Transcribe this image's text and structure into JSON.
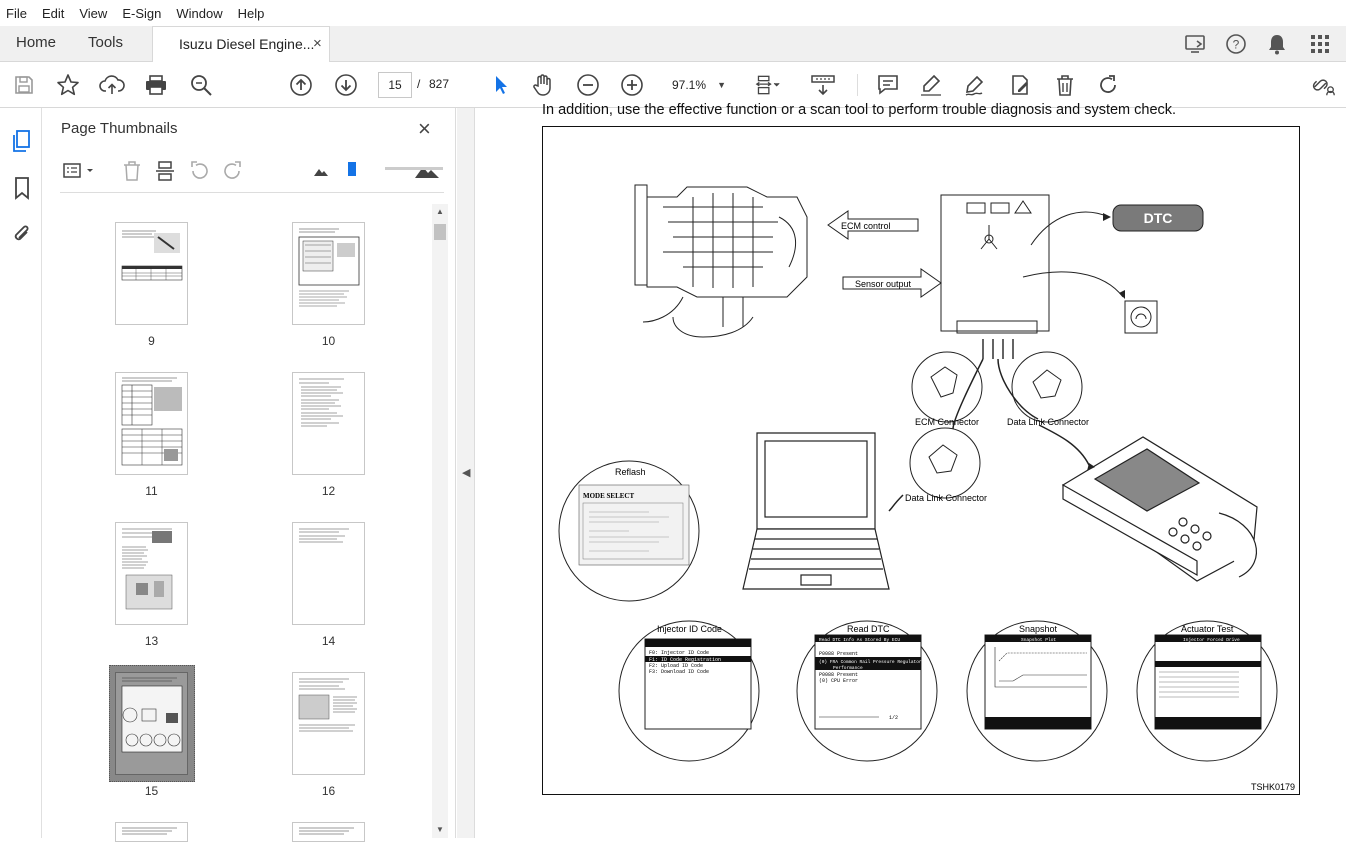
{
  "menu": [
    "File",
    "Edit",
    "View",
    "E-Sign",
    "Window",
    "Help"
  ],
  "tabs": {
    "home": "Home",
    "tools": "Tools",
    "doc_title": "Isuzu Diesel Engine...",
    "close": "×"
  },
  "toolbar": {
    "page_current": "15",
    "page_sep": "/",
    "page_total": "827",
    "zoom": "97.1%"
  },
  "panel": {
    "title": "Page Thumbnails",
    "close": "×"
  },
  "thumbnails": [
    {
      "label": "9"
    },
    {
      "label": "10"
    },
    {
      "label": "11"
    },
    {
      "label": "12"
    },
    {
      "label": "13"
    },
    {
      "label": "14"
    },
    {
      "label": "15"
    },
    {
      "label": "16"
    }
  ],
  "document": {
    "top_text": "In addition, use the effective function or a scan tool to perform trouble diagnosis and system check.",
    "figure": {
      "ecm_control": "ECM control",
      "sensor_output": "Sensor output",
      "dtc": "DTC",
      "ecm_connector": "ECM Connector",
      "data_link_connector_1": "Data Link Connector",
      "data_link_connector_2": "Data Link Connector",
      "reflash": "Reflash",
      "reflash_screen_title": "MODE SELECT",
      "injector_id_code": "Injector ID Code",
      "read_dtc": "Read DTC",
      "snapshot": "Snapshot",
      "actuator_test": "Actuator Test",
      "inj_lines": [
        "F0: Injector ID Code",
        "F1: ID Code Registration",
        "F2: Upload ID Code",
        "F3: Download ID Code"
      ],
      "dtc_lines": [
        "Read DTC Info As Stored By ECU",
        "P0088 Present",
        "(0) FRA Common Rail Pressure Regulator",
        "Performance",
        "P0088 Present",
        "(0) CPU Error"
      ],
      "dtc_page": "1/2",
      "snapshot_title": "Snapshot Plot",
      "actuator_title": "Injector Forced Drive",
      "code": "TSHK0179"
    }
  },
  "colors": {
    "accent": "#1473e6",
    "dtc_fill": "#7a7a7a"
  }
}
